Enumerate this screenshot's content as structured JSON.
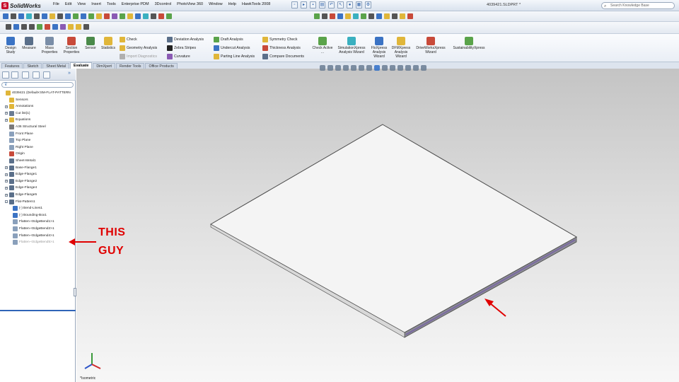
{
  "app": {
    "logo_text": "SolidWorks",
    "document_title": "4039421.SLDPRT *",
    "menus": [
      "File",
      "Edit",
      "View",
      "Insert",
      "Tools",
      "Enterprise PDM",
      "3Dcontrol",
      "PhotoView 360",
      "Window",
      "Help",
      "HawkTools 2008"
    ],
    "search_placeholder": "Search Knowledge Base"
  },
  "command_manager": {
    "big_tools": [
      {
        "label": "Design Study",
        "color": "#3b73c4"
      },
      {
        "label": "Measure",
        "color": "#5a6f8a"
      },
      {
        "label": "Mass Properties",
        "color": "#7a8ea8"
      },
      {
        "label": "Section Properties",
        "color": "#c84a3a"
      },
      {
        "label": "Sensor",
        "color": "#4a8a4a"
      },
      {
        "label": "Statistics",
        "color": "#e0b63a"
      }
    ],
    "small_tools": [
      {
        "label": "Check",
        "color": "#e0b63a",
        "disabled": false
      },
      {
        "label": "Geometry Analysis",
        "color": "#e0b63a",
        "disabled": false
      },
      {
        "label": "Import Diagnostics",
        "color": "#b0b0b0",
        "disabled": true
      },
      {
        "label": "Deviation Analysis",
        "color": "#5a6f8a",
        "disabled": false
      },
      {
        "label": "Zebra Stripes",
        "color": "#222222",
        "disabled": false
      },
      {
        "label": "Curvature",
        "color": "#8a5ab4",
        "disabled": false
      },
      {
        "label": "Draft Analysis",
        "color": "#5aa34a",
        "disabled": false
      },
      {
        "label": "Undercut Analysis",
        "color": "#3b73c4",
        "disabled": false
      },
      {
        "label": "Parting Line Analysis",
        "color": "#e0b63a",
        "disabled": false
      },
      {
        "label": "Symmetry Check",
        "color": "#e0b63a",
        "disabled": false
      },
      {
        "label": "Thickness Analysis",
        "color": "#c84a3a",
        "disabled": false
      },
      {
        "label": "Compare Documents",
        "color": "#5a6f8a",
        "disabled": false
      }
    ],
    "wizards": [
      {
        "label": "Check Active ...",
        "color": "#5aa34a"
      },
      {
        "label": "SimulationXpress Analysis Wizard",
        "color": "#3ab0c0"
      },
      {
        "label": "FloXpress Analysis Wizard",
        "color": "#3b73c4"
      },
      {
        "label": "DFMXpress Analysis Wizard",
        "color": "#e0b63a"
      },
      {
        "label": "DriveWorksXpress Wizard",
        "color": "#c84a3a"
      },
      {
        "label": "SustainabilityXpress",
        "color": "#5aa34a"
      }
    ]
  },
  "tabs": [
    "Features",
    "Sketch",
    "Sheet Metal",
    "Evaluate",
    "DimXpert",
    "Render Tools",
    "Office Products"
  ],
  "active_tab": "Evaluate",
  "tree": [
    {
      "label": "4039421 (Default<SM-FLAT-PATTERN",
      "indent": 0,
      "icon": "#e0b63a",
      "exp": "",
      "dim": false
    },
    {
      "label": "Sensors",
      "indent": 1,
      "icon": "#e0b63a",
      "exp": "",
      "dim": false
    },
    {
      "label": "Annotations",
      "indent": 1,
      "icon": "#e0b63a",
      "exp": "+",
      "dim": false
    },
    {
      "label": "Cut list(1)",
      "indent": 1,
      "icon": "#6a7c93",
      "exp": "+",
      "dim": false
    },
    {
      "label": "Equations",
      "indent": 1,
      "icon": "#e0b63a",
      "exp": "+",
      "dim": false
    },
    {
      "label": "A36 Structural Steel",
      "indent": 1,
      "icon": "#7a7a7a",
      "exp": "",
      "dim": false
    },
    {
      "label": "Front Plane",
      "indent": 1,
      "icon": "#8aa0bb",
      "exp": "",
      "dim": false
    },
    {
      "label": "Top Plane",
      "indent": 1,
      "icon": "#8aa0bb",
      "exp": "",
      "dim": false
    },
    {
      "label": "Right Plane",
      "indent": 1,
      "icon": "#8aa0bb",
      "exp": "",
      "dim": false
    },
    {
      "label": "Origin",
      "indent": 1,
      "icon": "#c84a3a",
      "exp": "",
      "dim": false
    },
    {
      "label": "Sheet-Metal1",
      "indent": 1,
      "icon": "#5a6f8a",
      "exp": "",
      "dim": false
    },
    {
      "label": "Base-Flange1",
      "indent": 1,
      "icon": "#5a6f8a",
      "exp": "+",
      "dim": false
    },
    {
      "label": "Edge-Flange1",
      "indent": 1,
      "icon": "#5a6f8a",
      "exp": "+",
      "dim": false
    },
    {
      "label": "Edge-Flange2",
      "indent": 1,
      "icon": "#5a6f8a",
      "exp": "+",
      "dim": false
    },
    {
      "label": "Edge-Flange4",
      "indent": 1,
      "icon": "#5a6f8a",
      "exp": "+",
      "dim": false
    },
    {
      "label": "Edge-Flange5",
      "indent": 1,
      "icon": "#5a6f8a",
      "exp": "+",
      "dim": false
    },
    {
      "label": "Flat-Pattern1",
      "indent": 1,
      "icon": "#5a6f8a",
      "exp": "-",
      "dim": false
    },
    {
      "label": "(-) Bend-Lines1",
      "indent": 2,
      "icon": "#3b73c4",
      "exp": "",
      "dim": false
    },
    {
      "label": "(-) Bounding-Box1",
      "indent": 2,
      "icon": "#3b73c4",
      "exp": "",
      "dim": false
    },
    {
      "label": "Flatten-<EdgeBend1>1",
      "indent": 2,
      "icon": "#8aa0bb",
      "exp": "",
      "dim": false
    },
    {
      "label": "Flatten-<EdgeBend2>1",
      "indent": 2,
      "icon": "#8aa0bb",
      "exp": "",
      "dim": false
    },
    {
      "label": "Flatten-<EdgeBend4>1",
      "indent": 2,
      "icon": "#8aa0bb",
      "exp": "",
      "dim": false
    },
    {
      "label": "Flatten-<EdgeBend5>1",
      "indent": 2,
      "icon": "#8aa0bb",
      "exp": "",
      "dim": true
    }
  ],
  "view": {
    "orientation_label": "*Isometric"
  },
  "annotation": {
    "line1": "THIS",
    "line2": "GUY",
    "color": "#e00000"
  },
  "colors": {
    "accent": "#2f64b8",
    "part_face": "#f4f4f4",
    "part_edge_side": "#8c8c95",
    "part_highlight": "#7a6aa0"
  }
}
